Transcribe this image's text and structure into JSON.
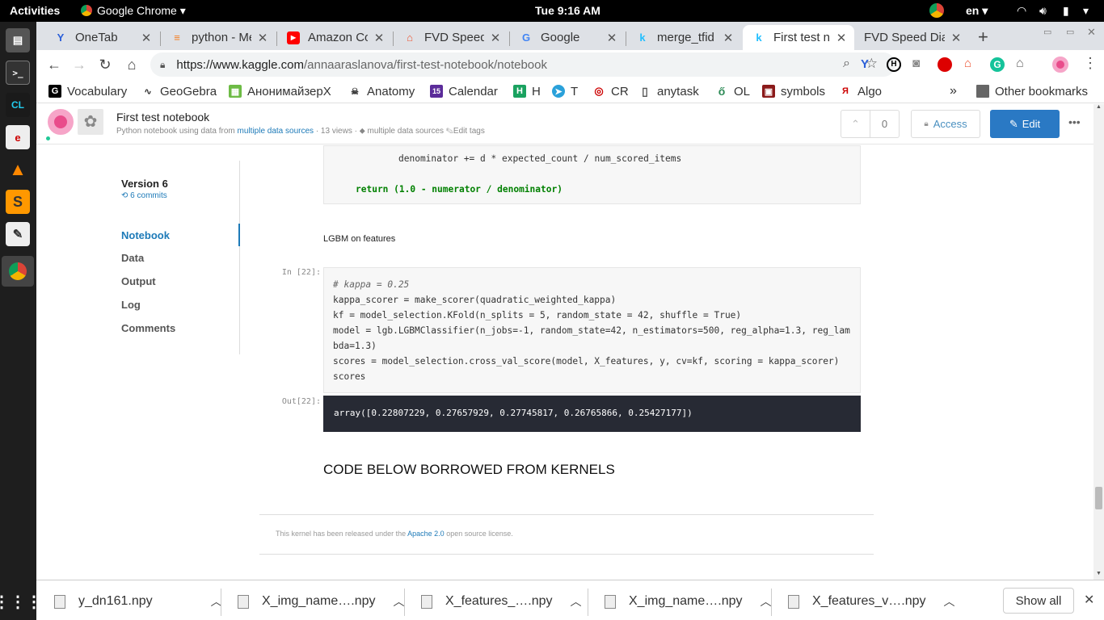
{
  "topbar": {
    "activities": "Activities",
    "app": "Google Chrome",
    "clock": "Tue  9:16 AM",
    "lang": "en"
  },
  "tabs": [
    {
      "label": "OneTab",
      "icon": "onetab-icon"
    },
    {
      "label": "python - Me",
      "icon": "stackoverflow-icon"
    },
    {
      "label": "Amazon Co",
      "icon": "youtube-icon"
    },
    {
      "label": "FVD Speed",
      "icon": "fvd-icon"
    },
    {
      "label": "Google",
      "icon": "google-icon"
    },
    {
      "label": "merge_tfid",
      "icon": "kaggle-icon"
    },
    {
      "label": "First test nc",
      "icon": "kaggle-icon"
    },
    {
      "label": "FVD Speed Dial",
      "icon": "fvd-icon"
    }
  ],
  "omnibox": {
    "url_host": "https://www.kaggle.com",
    "url_path": "/annaaraslanova/first-test-notebook/notebook"
  },
  "bookmarks": [
    {
      "label": "Vocabulary",
      "color": "#ffffff",
      "glyph": "G",
      "fg": "#000000"
    },
    {
      "label": "GeoGebra",
      "color": "#ffffff",
      "glyph": "∿",
      "fg": "#333333"
    },
    {
      "label": "АнонимайзерX",
      "color": "#6dbb45",
      "glyph": "▦",
      "fg": "#ffffff"
    },
    {
      "label": "Anatomy",
      "color": "#ffffff",
      "glyph": "☠",
      "fg": "#333333"
    },
    {
      "label": "Calendar",
      "color": "#5b2c9a",
      "glyph": "15",
      "fg": "#ffffff"
    },
    {
      "label": "H",
      "color": "#1aa260",
      "glyph": "H",
      "fg": "#ffffff"
    },
    {
      "label": "T",
      "color": "#2aa1da",
      "glyph": "➤",
      "fg": "#ffffff"
    },
    {
      "label": "CR",
      "color": "#ffffff",
      "glyph": "◎",
      "fg": "#cc0000"
    },
    {
      "label": "anytask",
      "color": "#ffffff",
      "glyph": "▯",
      "fg": "#555555"
    },
    {
      "label": "OL",
      "color": "#ffffff",
      "glyph": "ő",
      "fg": "#2e8b57"
    },
    {
      "label": "symbols",
      "color": "#8b1a1a",
      "glyph": "▣",
      "fg": "#ffffff"
    },
    {
      "label": "Algo",
      "color": "#ffffff",
      "glyph": "Я",
      "fg": "#cc0000"
    }
  ],
  "other_bookmarks": "Other bookmarks",
  "kaggle": {
    "title": "First test notebook",
    "subtitle_prefix": "Python notebook using data from",
    "subtitle_link": "multiple data sources",
    "subtitle_views": "· 13 views ·",
    "subtitle_tags": "multiple data sources",
    "subtitle_edit": "Edit tags",
    "votes": "0",
    "access": "Access",
    "edit": "Edit"
  },
  "sidebar": {
    "version": "Version 6",
    "commits": "6 commits",
    "items": [
      {
        "label": "Notebook",
        "active": true
      },
      {
        "label": "Data",
        "active": false
      },
      {
        "label": "Output",
        "active": false
      },
      {
        "label": "Log",
        "active": false
      },
      {
        "label": "Comments",
        "active": false
      }
    ]
  },
  "notebook": {
    "prev_code_line1": "denominator += d * expected_count / num_scored_items",
    "prev_code_line2": "return (1.0 - numerator / denominator)",
    "markdown1": "LGBM on features",
    "in_prompt": "In [22]:",
    "out_prompt": "Out[22]:",
    "code_lines": [
      "# kappa = 0.25",
      "kappa_scorer = make_scorer(quadratic_weighted_kappa)",
      "kf = model_selection.KFold(n_splits = 5, random_state = 42, shuffle = True)",
      "model = lgb.LGBMClassifier(n_jobs=-1, random_state=42, n_estimators=500, reg_alpha=1.3, reg_lam",
      "bda=1.3)",
      "scores = model_selection.cross_val_score(model, X_features, y, cv=kf, scoring = kappa_scorer)",
      "scores"
    ],
    "output": "array([0.22807229, 0.27657929, 0.27745817, 0.26765866, 0.25427177])",
    "heading": "CODE BELOW BORROWED FROM KERNELS",
    "license_prefix": "This kernel has been released under the",
    "license_link": "Apache 2.0",
    "license_suffix": "open source license."
  },
  "downloads": [
    {
      "name": "y_dn161.npy"
    },
    {
      "name": "X_img_name….npy"
    },
    {
      "name": "X_features_….npy"
    },
    {
      "name": "X_img_name….npy"
    },
    {
      "name": "X_features_v….npy"
    }
  ],
  "show_all": "Show all"
}
